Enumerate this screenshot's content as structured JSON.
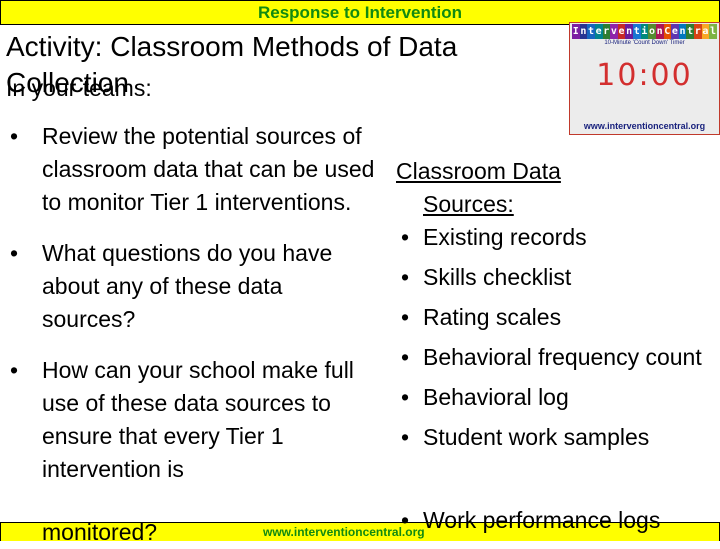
{
  "header": {
    "banner": "Response to Intervention"
  },
  "slide": {
    "title": "Activity: Classroom Methods of Data Collection",
    "subtitle": "In your teams:",
    "left_bullets": [
      "Review the potential sources of classroom data that can be used to monitor Tier 1 interventions.",
      "What questions do you have about any of these data sources?",
      "How can your school make full use of these data sources to ensure that every Tier 1 intervention is"
    ],
    "left_overflow": "monitored?",
    "right_heading_line1": "Classroom Data",
    "right_heading_line2": "Sources:",
    "right_bullets": [
      "Existing records",
      "Skills checklist",
      "Rating scales",
      "Behavioral frequency count",
      "Behavioral log",
      "Student work samples"
    ],
    "right_overflow": "Work performance logs",
    "bullet_glyph": "•"
  },
  "timer": {
    "logo_letters": [
      "I",
      "n",
      "t",
      "e",
      "r",
      "v",
      "e",
      "n",
      "t",
      "i",
      "o",
      "n",
      "C",
      "e",
      "n",
      "t",
      "r",
      "a",
      "l"
    ],
    "logo_colors": [
      "#7b1fa2",
      "#283593",
      "#1565c0",
      "#00838f",
      "#2e7d32",
      "#8e24aa",
      "#c62828",
      "#6a1b9a",
      "#1976d2",
      "#00897b",
      "#558b2f",
      "#ad1457",
      "#e65100",
      "#5e35b1",
      "#0277bd",
      "#2e7d32",
      "#d84315",
      "#f9a825",
      "#7cb342"
    ],
    "subtitle": "10-Minute 'Count Down' Timer",
    "time": "10:00",
    "url": "www.interventioncentral.org"
  },
  "footer": {
    "url": "www.interventioncentral.org"
  },
  "colors": {
    "banner_bg": "#ffff00",
    "banner_text": "#118a11",
    "timer_digits": "#d32f2f"
  }
}
